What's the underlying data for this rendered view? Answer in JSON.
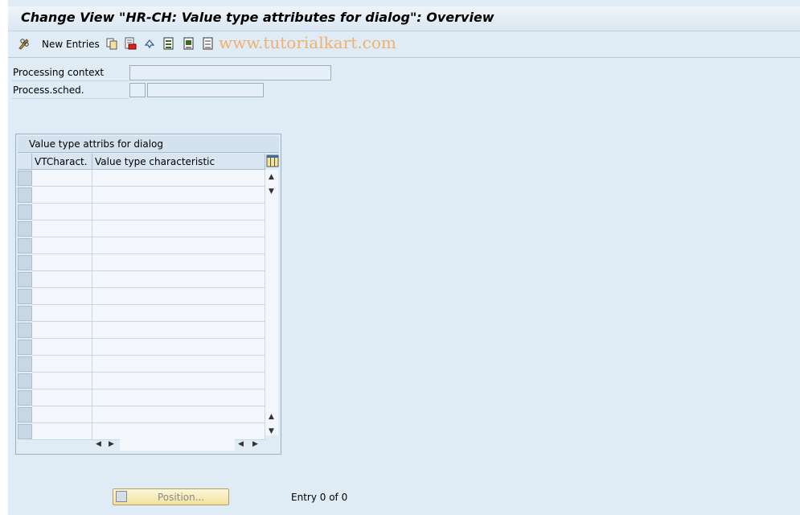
{
  "window": {
    "title": "Change View \"HR-CH: Value type attributes for dialog\": Overview"
  },
  "toolbar": {
    "new_entries_label": "New Entries",
    "watermark": "www.tutorialkart.com",
    "icons": [
      "pencil-glasses-icon",
      "copy-icon",
      "delete-icon",
      "undo-icon",
      "select-all-icon",
      "select-block-icon",
      "deselect-all-icon"
    ]
  },
  "form": {
    "processing_context": {
      "label": "Processing context",
      "value": ""
    },
    "process_sched": {
      "label": "Process.sched.",
      "value": "",
      "text_value": ""
    }
  },
  "table": {
    "title": "Value type attribs for dialog",
    "columns": [
      "VTCharact.",
      "Value type characteristic"
    ],
    "rows": [
      [
        "",
        ""
      ],
      [
        "",
        ""
      ],
      [
        "",
        ""
      ],
      [
        "",
        ""
      ],
      [
        "",
        ""
      ],
      [
        "",
        ""
      ],
      [
        "",
        ""
      ],
      [
        "",
        ""
      ],
      [
        "",
        ""
      ],
      [
        "",
        ""
      ],
      [
        "",
        ""
      ],
      [
        "",
        ""
      ],
      [
        "",
        ""
      ],
      [
        "",
        ""
      ],
      [
        "",
        ""
      ],
      [
        "",
        ""
      ]
    ]
  },
  "footer": {
    "position_button_label": "Position...",
    "entry_text": "Entry 0 of 0"
  },
  "colors": {
    "background": "#dfebf5",
    "watermark": "#f0b070",
    "button": "#f2e3a0"
  }
}
